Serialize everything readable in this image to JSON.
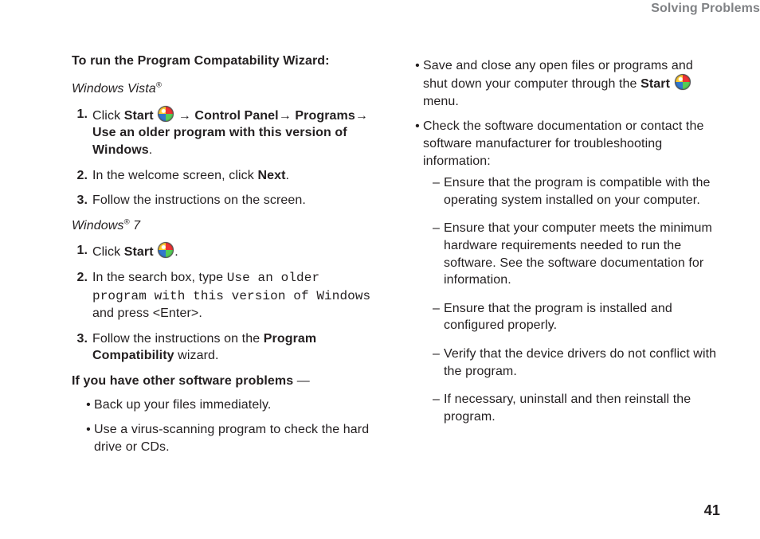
{
  "header": "Solving Problems",
  "page_number": "41",
  "left": {
    "heading": "To run the Program Compatability Wizard:",
    "os1_pre": "Windows Vista",
    "reg": "®",
    "os2_pre": "Windows",
    "os2_post": " 7",
    "vista": {
      "s1_a": "Click ",
      "s1_b": "Start",
      "s1_c": " ",
      "s1_d": "→ ",
      "s1_e": "Control Panel",
      "s1_f": "→ ",
      "s1_g": "Programs",
      "s1_h": "→ ",
      "s1_i": "Use an older program with this version of Windows",
      "s1_j": ".",
      "s2_a": "In the welcome screen, click ",
      "s2_b": "Next",
      "s2_c": ".",
      "s3": "Follow the instructions on the screen."
    },
    "win7": {
      "s1_a": "Click ",
      "s1_b": "Start",
      "s1_c": " ",
      "s1_d": ".",
      "s2_a": "In the search box, type ",
      "s2_b": "Use an older program with this version of Windows",
      "s2_c": " and press <Enter>.",
      "s3_a": "Follow the instructions on the ",
      "s3_b": "Program Compatibility",
      "s3_c": " wizard."
    },
    "other_heading": "If you have other software problems",
    "other_dash": " —",
    "other": {
      "b1": "Back up your files immediately.",
      "b2": "Use a virus-scanning program to check the hard drive or CDs."
    }
  },
  "right": {
    "b1_a": "Save and close any open files or programs and shut down your computer through the ",
    "b1_b": "Start",
    "b1_c": " ",
    "b1_d": " menu.",
    "b2": "Check the software documentation or contact the software manufacturer for troubleshooting information:",
    "d1": "Ensure that the program is compatible with the operating system installed on your computer.",
    "d2": "Ensure that your computer meets the minimum hardware requirements needed to run the software. See the software documentation for information.",
    "d3": "Ensure that the program is installed and configured properly.",
    "d4": "Verify that the device drivers do not conflict with the program.",
    "d5": "If necessary, uninstall and then reinstall the program."
  },
  "num": {
    "n1": "1.",
    "n2": "2.",
    "n3": "3."
  },
  "sym": {
    "bullet": "•",
    "dash": "–"
  }
}
